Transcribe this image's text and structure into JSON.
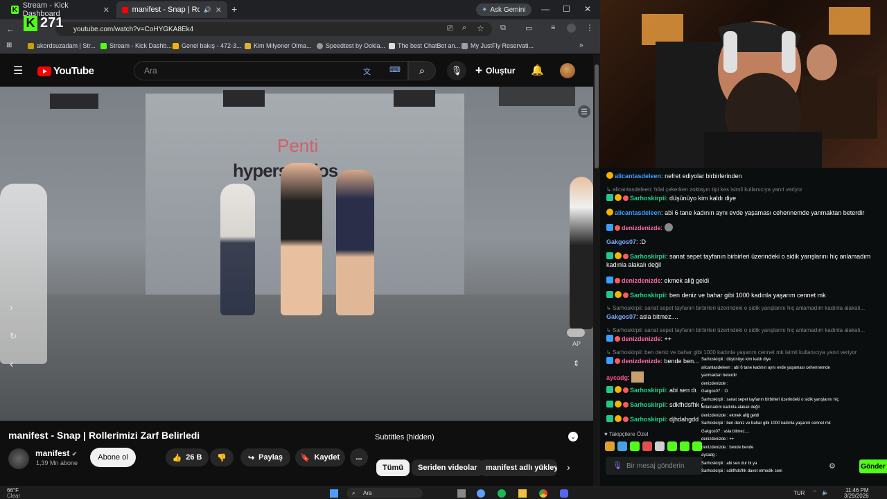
{
  "browser": {
    "tabs": [
      {
        "label": "Stream - Kick Dashboard",
        "active": false
      },
      {
        "label": "manifest - Snap | Rollerimiz",
        "active": true
      }
    ],
    "new_tab": "+",
    "gemini": "Ask Gemini",
    "url": "youtube.com/watch?v=CoHYGKA8Ek4",
    "kick_viewers": "271",
    "bookmarks": [
      "akordsuzadam | Str...",
      "Stream - Kick Dashb...",
      "Genel bakış - 472-3...",
      "Kim Milyoner Olma...",
      "Speedtest by Ookla...",
      "The best ChatBot an...",
      "My JustFly Reservati..."
    ]
  },
  "youtube": {
    "logo_text": "YouTube",
    "search_placeholder": "Ara",
    "create_label": "Oluştur",
    "video": {
      "wall_text_1": "Penti",
      "wall_text_2": "hyperstudios",
      "autoplay_label": "AP"
    },
    "title": "manifest - Snap | Rollerimizi Zarf Belirledi",
    "channel": {
      "name": "manifest",
      "subs": "1,39 Mn abone",
      "subscribe_label": "Abone ol"
    },
    "actions": {
      "likes": "26 B",
      "share": "Paylaş",
      "save": "Kaydet",
      "more": "..."
    },
    "subtitles_label": "Subtitles (hidden)",
    "chips": [
      "Tümü",
      "Seriden videolar",
      "manifest adlı yükleyi"
    ]
  },
  "chat": {
    "messages": [
      {
        "user": "alicantasdeleen",
        "text": "nefret ediyolar birbirlerinden",
        "color": "#3aa0ff"
      },
      {
        "reply": "alicantasdeleen: hilal çekerken zoktayın tipi kes isimli kullanıcıya yanıt veriyor"
      },
      {
        "user": "Sarhoskirpii",
        "text": "düşünüyo kim kaldı diye",
        "color": "#23d18b"
      },
      {
        "user": "alicantasdeleen",
        "text": "abi 6 tane kadının aynı evde yaşaması cehennemde yanmaktan beterdir",
        "color": "#3aa0ff"
      },
      {
        "user": "denizdenizde",
        "text": "",
        "color": "#ff6aa8"
      },
      {
        "user": "Gakgos07",
        "text": ":D",
        "color": "#7aa8ff"
      },
      {
        "user": "Sarhoskirpii",
        "text": "sanat sepet tayfanın birbirleri üzerindeki o sidik yarışlarını hiç anlamadım kadınla alakalı değil",
        "color": "#23d18b"
      },
      {
        "user": "denizdenizde",
        "text": "ekmek aliğ geldi",
        "color": "#ff6aa8"
      },
      {
        "user": "Sarhoskirpii",
        "text": "ben deniz ve bahar gibi 1000 kadınla yaşarım cennet mk",
        "color": "#23d18b"
      },
      {
        "reply": "Sarhoskirpii: sanat sepet tayfanın birbirleri üzerindeki o sidik yarışlarını hiç anlamadım kadınla alakalı..."
      },
      {
        "user": "Gakgos07",
        "text": "asla bitmez....",
        "color": "#7aa8ff"
      },
      {
        "reply": "Sarhoskirpii: sanat sepet tayfanın birbirleri üzerindeki o sidik yarışlarını hiç anlamadım kadınla alakalı..."
      },
      {
        "user": "denizdenizde",
        "text": "++",
        "color": "#ff6aa8"
      },
      {
        "reply": "Sarhoskirpii: ben deniz ve bahar gibi 1000 kadınla yaşarım cennet mk isimli kullanıcıya yanıt veriyor"
      },
      {
        "user": "denizdenizde",
        "text": "bende ben...",
        "color": "#ff6aa8"
      },
      {
        "user": "aycadg",
        "text": "",
        "color": "#ff4f8b"
      },
      {
        "user": "Sarhoskirpii",
        "text": "abi sen dur bi ya",
        "color": "#23d18b"
      },
      {
        "user": "Sarhoskirpii",
        "text": "sdkfhdsfhk davet etmedik seni",
        "color": "#23d18b"
      },
      {
        "user": "Sarhoskirpii",
        "text": "djhdahgdd",
        "color": "#23d18b"
      }
    ],
    "follower_mode": "Takipçilere Özel",
    "input_placeholder": "Bir mesaj gönderin",
    "send_label": "Gönder"
  },
  "overlay_chat": [
    "Sarhoskirpii : düşünüyo kim kaldı diye",
    "alicantasdeleen : abi 6 tane kadının aynı evde yaşaması cehennemde",
    "yanmaktan beterdir",
    "denizdenizde :",
    "Gakgos07 : :D",
    "Sarhoskirpii : sanat sepet tayfanın birbirleri üzerindeki o sidik yarışlarını hiç",
    "anlamadım kadınla alakalı değil",
    "denizdenizde : ekmek aliğ geldi",
    "Sarhoskirpii : ben deniz ve bahar gibi 1000 kadınla yaşarım cennet mk",
    "Gakgos07 : asla bitmez....",
    "denizdenizde : ++",
    "denizdenizde : bende bende",
    "aycadg :",
    "Sarhoskirpii : abi sen dur bi ya",
    "Sarhoskirpii : sdkfhdsfhk davet etmedik seni"
  ],
  "taskbar": {
    "weather_temp": "66°F",
    "weather_desc": "Clear",
    "search": "Ara",
    "lang": "TUR",
    "time": "11:46 PM",
    "date": "3/29/2026"
  }
}
